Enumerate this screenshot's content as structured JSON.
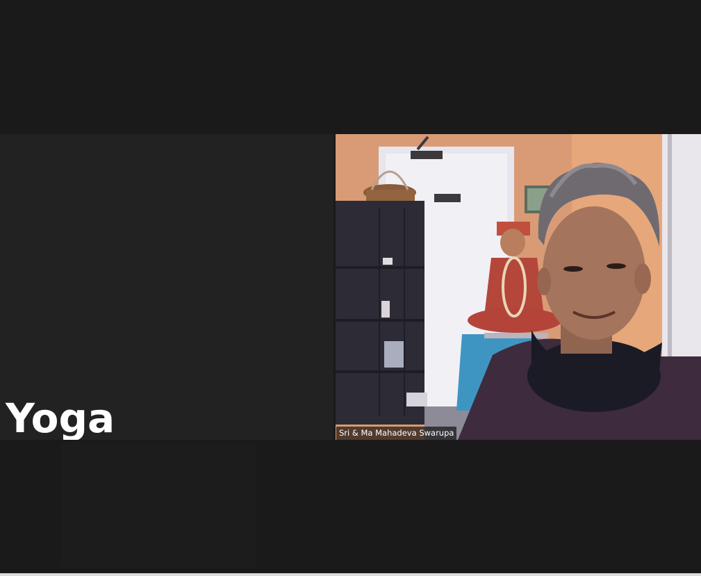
{
  "participants": [
    {
      "display_name": "Yoga",
      "video": "off"
    },
    {
      "display_name": "Sri & Ma Mahadeva Swarupa",
      "video": "on"
    }
  ],
  "colors": {
    "background": "#1a1a1a",
    "tile_off": "#222222",
    "name_text": "#ffffff"
  }
}
